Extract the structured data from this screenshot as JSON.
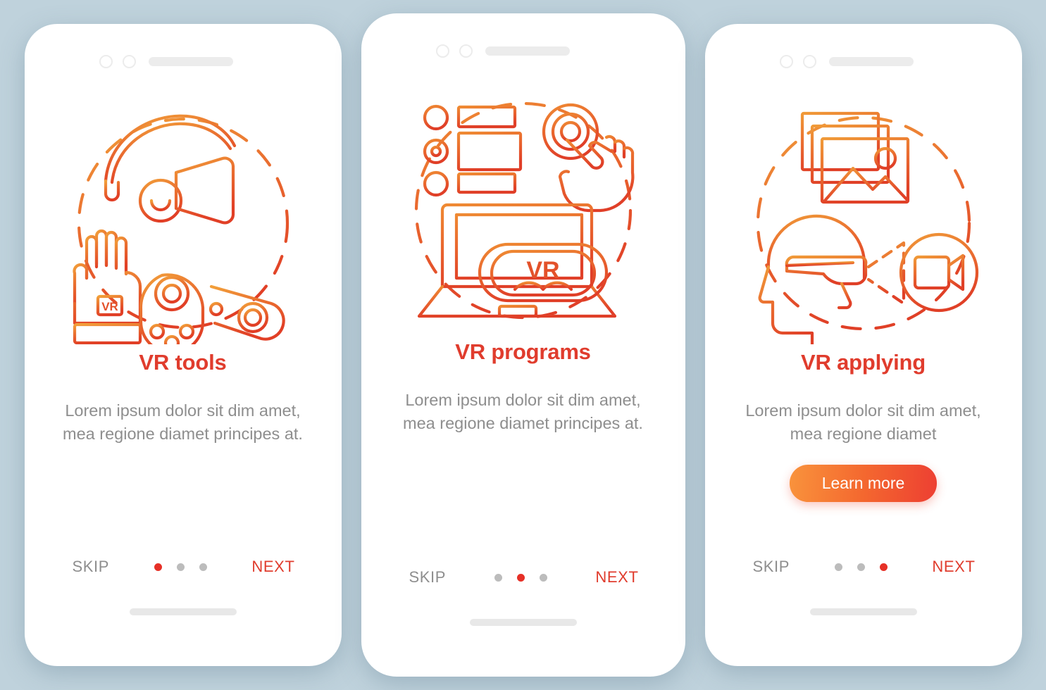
{
  "background_color": "#bfd2dc",
  "accent": {
    "title_red": "#e03c2d",
    "dot_active": "#e63027",
    "dot_inactive": "#bcbcbc",
    "muted_text": "#8e8e8e",
    "gradient_from": "#f9933c",
    "gradient_to": "#ed3f32"
  },
  "screens": [
    {
      "id": "vr-tools",
      "illustration": "vr-hardware-illustration",
      "title": "VR tools",
      "description": "Lorem ipsum dolor sit dim amet, mea regione diamet principes at.",
      "cta": null,
      "skip_label": "SKIP",
      "next_label": "NEXT",
      "dots": 3,
      "active_dot": 1
    },
    {
      "id": "vr-programs",
      "illustration": "vr-software-illustration",
      "title": "VR programs",
      "description": "Lorem ipsum dolor sit dim amet, mea regione diamet principes at.",
      "cta": null,
      "skip_label": "SKIP",
      "next_label": "NEXT",
      "dots": 3,
      "active_dot": 2
    },
    {
      "id": "vr-applying",
      "illustration": "vr-applying-illustration",
      "title": "VR applying",
      "description": "Lorem ipsum dolor sit dim amet, mea regione diamet",
      "cta": "Learn more",
      "skip_label": "SKIP",
      "next_label": "NEXT",
      "dots": 3,
      "active_dot": 3
    }
  ],
  "illustration_labels": {
    "glove_badge": "VR",
    "goggles_badge": "VR"
  }
}
